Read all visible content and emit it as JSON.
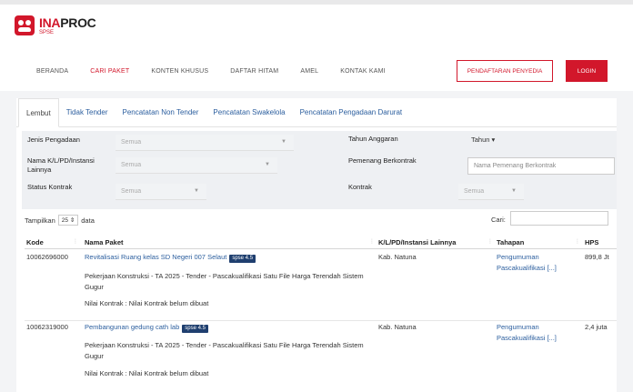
{
  "brand": {
    "name_a": "INA",
    "name_b": "PROC",
    "sub": "SPSE"
  },
  "nav": {
    "items": [
      "BERANDA",
      "CARI PAKET",
      "KONTEN KHUSUS",
      "DAFTAR HITAM",
      "AMEL",
      "KONTAK KAMI"
    ],
    "register": "PENDAFTARAN PENYEDIA",
    "login": "LOGIN"
  },
  "tabs": [
    "Lembut",
    "Tidak Tender",
    "Pencatatan Non Tender",
    "Pencatatan Swakelola",
    "Pencatatan Pengadaan Darurat"
  ],
  "filters": {
    "jenis_label": "Jenis Pengadaan",
    "jenis_value": "Semua",
    "instansi_label": "Nama K/L/PD/Instansi Lainnya",
    "instansi_value": "Semua",
    "status_label": "Status Kontrak",
    "status_value": "Semua",
    "tahun_label": "Tahun Anggaran",
    "tahun_value": "Tahun",
    "pemenang_label": "Pemenang Berkontrak",
    "pemenang_placeholder": "Nama Pemenang Berkontrak",
    "kontrak_label": "Kontrak",
    "kontrak_value": "Semua"
  },
  "table_controls": {
    "show_label": "Tampilkan",
    "page_size": "25",
    "data_label": "data",
    "search_label": "Cari:"
  },
  "columns": [
    "Kode",
    "Nama Paket",
    "K/L/PD/Instansi Lainnya",
    "Tahapan",
    "HPS"
  ],
  "rows": [
    {
      "kode": "10062696000",
      "nama": "Revitalisasi Ruang kelas SD Negeri 007 Selaut",
      "badge": "spse 4.5",
      "desc": "Pekerjaan Konstruksi - TA 2025 - Tender - Pascakualifikasi Satu File Harga Terendah Sistem Gugur",
      "nilai": "Nilai Kontrak : Nilai Kontrak belum dibuat",
      "instansi": "Kab. Natuna",
      "tahapan": "Pengumuman Pascakualifikasi [...]",
      "hps": "899,8 Jt"
    },
    {
      "kode": "10062319000",
      "nama": "Pembangunan gedung cath lab",
      "badge": "spse 4.5",
      "desc": "Pekerjaan Konstruksi - TA 2025 - Tender - Pascakualifikasi Satu File Harga Terendah Sistem Gugur",
      "nilai": "Nilai Kontrak : Nilai Kontrak belum dibuat",
      "instansi": "Kab. Natuna",
      "tahapan": "Pengumuman Pascakualifikasi [...]",
      "hps": "2,4 juta"
    }
  ]
}
